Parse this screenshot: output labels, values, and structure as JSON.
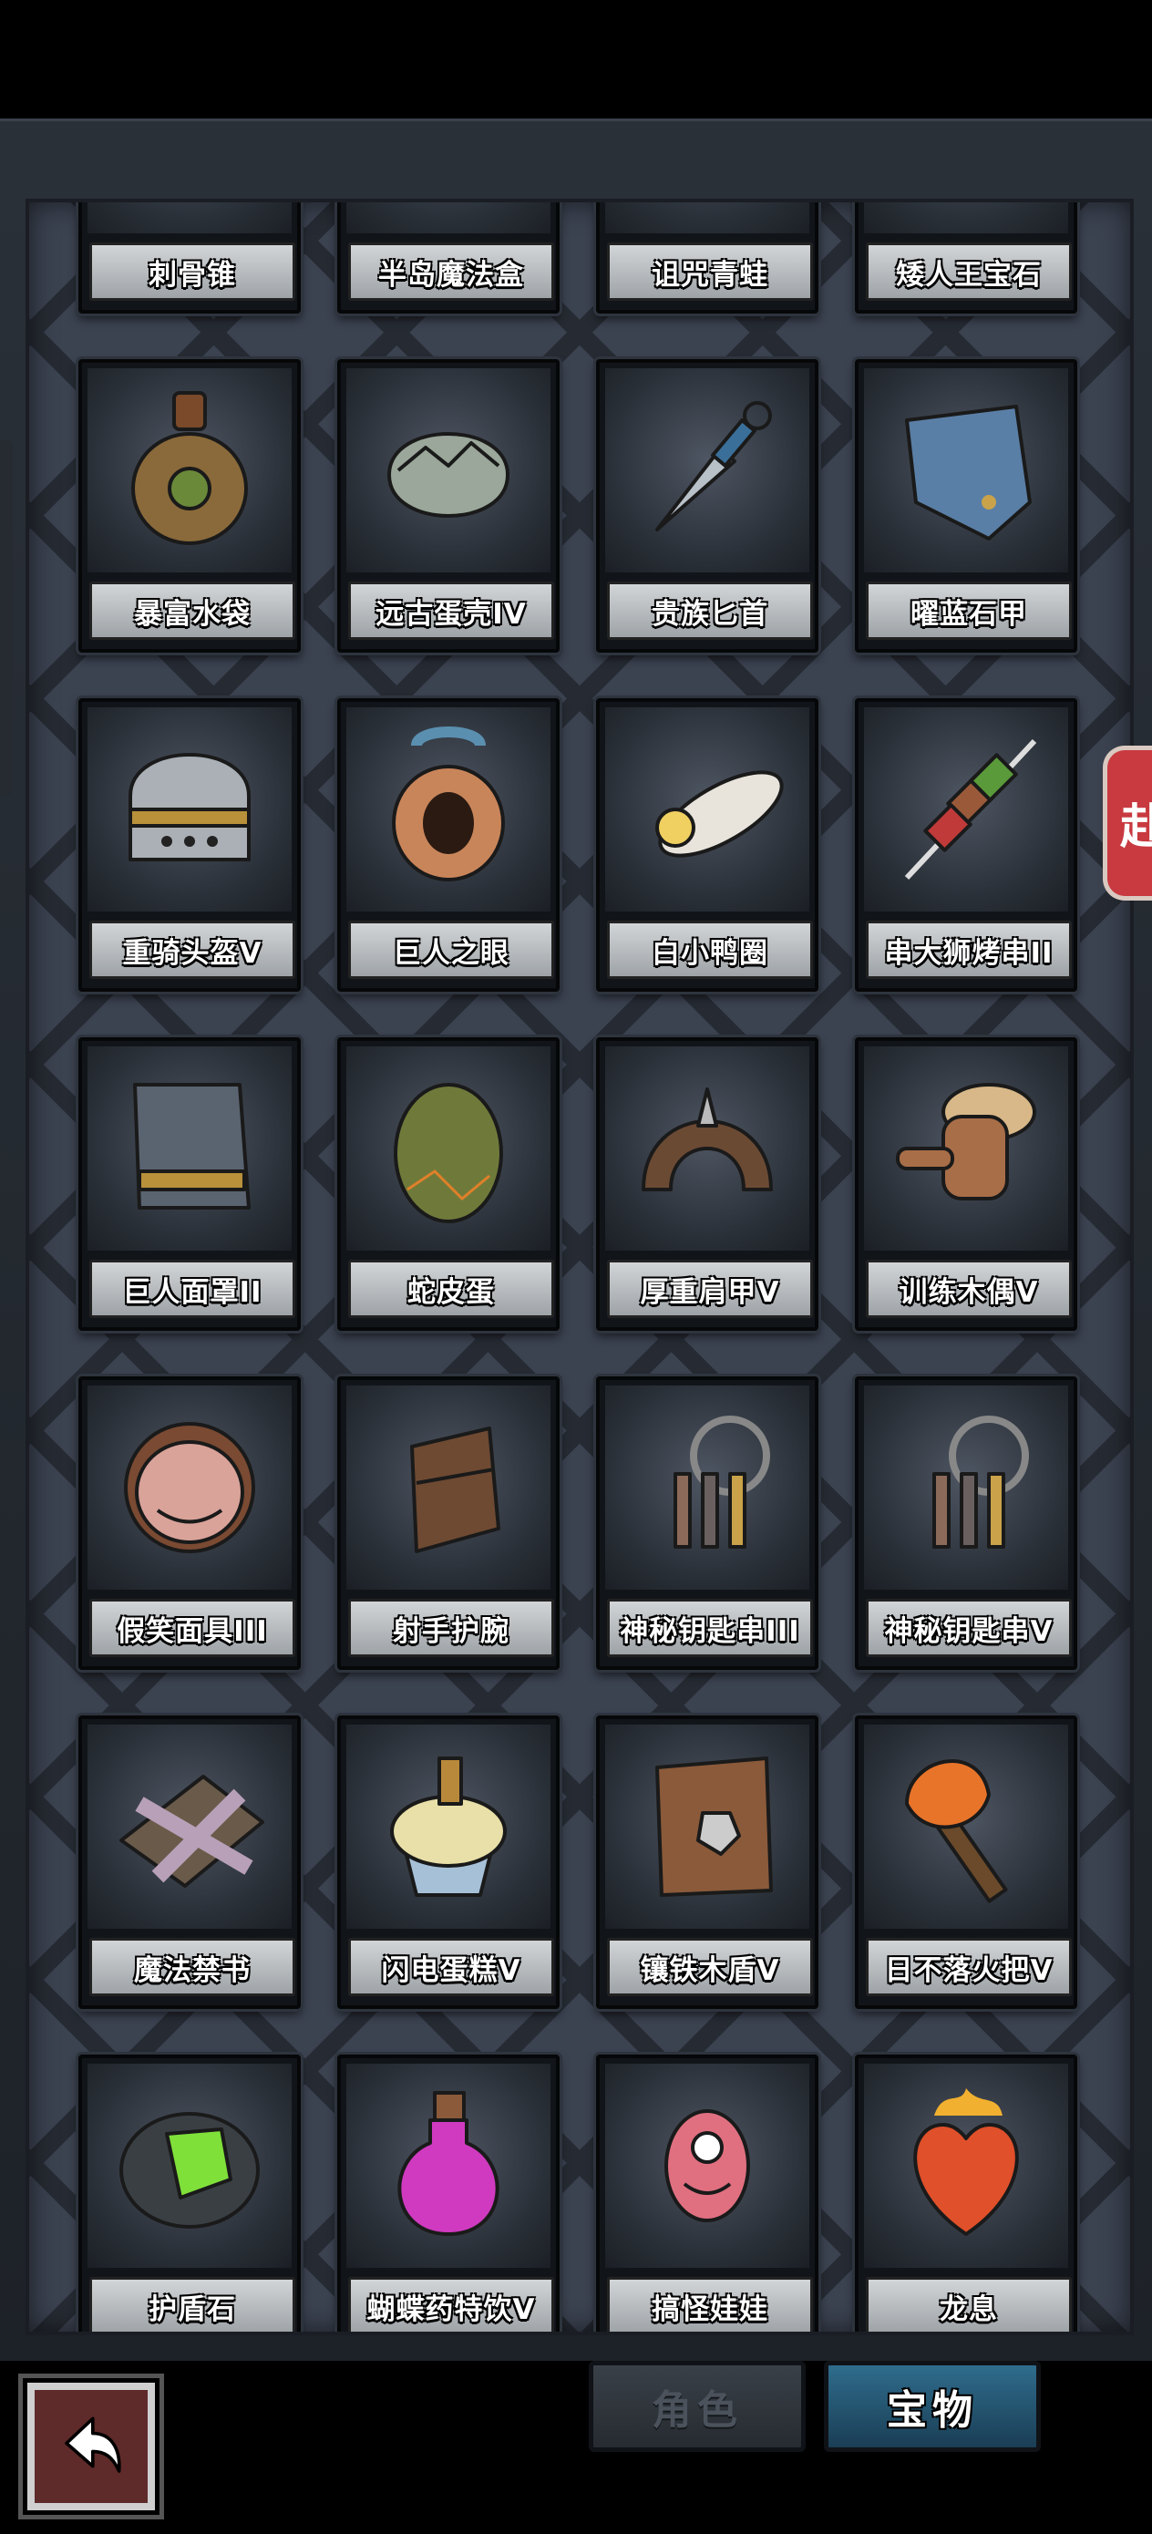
{
  "screen": {
    "title": ""
  },
  "side_tab": {
    "label": "赴"
  },
  "items": [
    {
      "name": "刺骨锥",
      "icon": "bone-spike-icon",
      "color": "#c9895a"
    },
    {
      "name": "半岛魔法盒",
      "icon": "magic-box-icon",
      "color": "#8a8f96"
    },
    {
      "name": "诅咒青蛙",
      "icon": "cursed-frog-icon",
      "color": "#7a5a3a"
    },
    {
      "name": "矮人王宝石",
      "icon": "dwarf-gem-icon",
      "color": "#7b5bd6"
    },
    {
      "name": "暴富水袋",
      "icon": "water-pouch-icon",
      "color": "#8a6a3a"
    },
    {
      "name": "远古蛋壳IV",
      "icon": "egg-shell-icon",
      "color": "#9aa79a"
    },
    {
      "name": "贵族匕首",
      "icon": "kunai-dagger-icon",
      "color": "#b8c0c8"
    },
    {
      "name": "曜蓝石甲",
      "icon": "blue-stone-armor-icon",
      "color": "#5a7fa6"
    },
    {
      "name": "重骑头盔V",
      "icon": "knight-helmet-icon",
      "color": "#aab0b6"
    },
    {
      "name": "巨人之眼",
      "icon": "giant-eye-icon",
      "color": "#c9855a"
    },
    {
      "name": "白小鸭圈",
      "icon": "duck-ring-icon",
      "color": "#e8e4dc"
    },
    {
      "name": "串大狮烤串II",
      "icon": "kebab-icon",
      "color": "#9a5a3a"
    },
    {
      "name": "巨人面罩II",
      "icon": "giant-mask-icon",
      "color": "#5a6470"
    },
    {
      "name": "蛇皮蛋",
      "icon": "snake-egg-icon",
      "color": "#6f7a3a"
    },
    {
      "name": "厚重肩甲V",
      "icon": "shoulder-armor-icon",
      "color": "#6b4a34"
    },
    {
      "name": "训练木偶V",
      "icon": "training-dummy-icon",
      "color": "#a86e48"
    },
    {
      "name": "假笑面具III",
      "icon": "smile-mask-icon",
      "color": "#d9a39a"
    },
    {
      "name": "射手护腕",
      "icon": "archer-bracer-icon",
      "color": "#6e4a32"
    },
    {
      "name": "神秘钥匙串III",
      "icon": "key-ring-icon",
      "color": "#8c6a5a"
    },
    {
      "name": "神秘钥匙串V",
      "icon": "key-ring-icon",
      "color": "#8c6a5a"
    },
    {
      "name": "魔法禁书",
      "icon": "forbidden-book-icon",
      "color": "#b7a0b8"
    },
    {
      "name": "闪电蛋糕V",
      "icon": "cupcake-icon",
      "color": "#a6c0d8"
    },
    {
      "name": "镶铁木盾V",
      "icon": "iron-wood-shield-icon",
      "color": "#8a5a3a"
    },
    {
      "name": "日不落火把V",
      "icon": "torch-icon",
      "color": "#e8742a"
    },
    {
      "name": "护盾石",
      "icon": "green-crystal-stone-icon",
      "color": "#7fe03a"
    },
    {
      "name": "蝴蝶药特饮V",
      "icon": "potion-icon",
      "color": "#d03ac0"
    },
    {
      "name": "搞怪娃娃",
      "icon": "monster-doll-icon",
      "color": "#e07080"
    },
    {
      "name": "龙息",
      "icon": "flaming-heart-icon",
      "color": "#e0502a"
    }
  ],
  "bottom_nav": {
    "back_icon": "back-arrow-icon",
    "tabs": [
      {
        "label": "角色",
        "active": false
      },
      {
        "label": "宝物",
        "active": true
      }
    ]
  }
}
